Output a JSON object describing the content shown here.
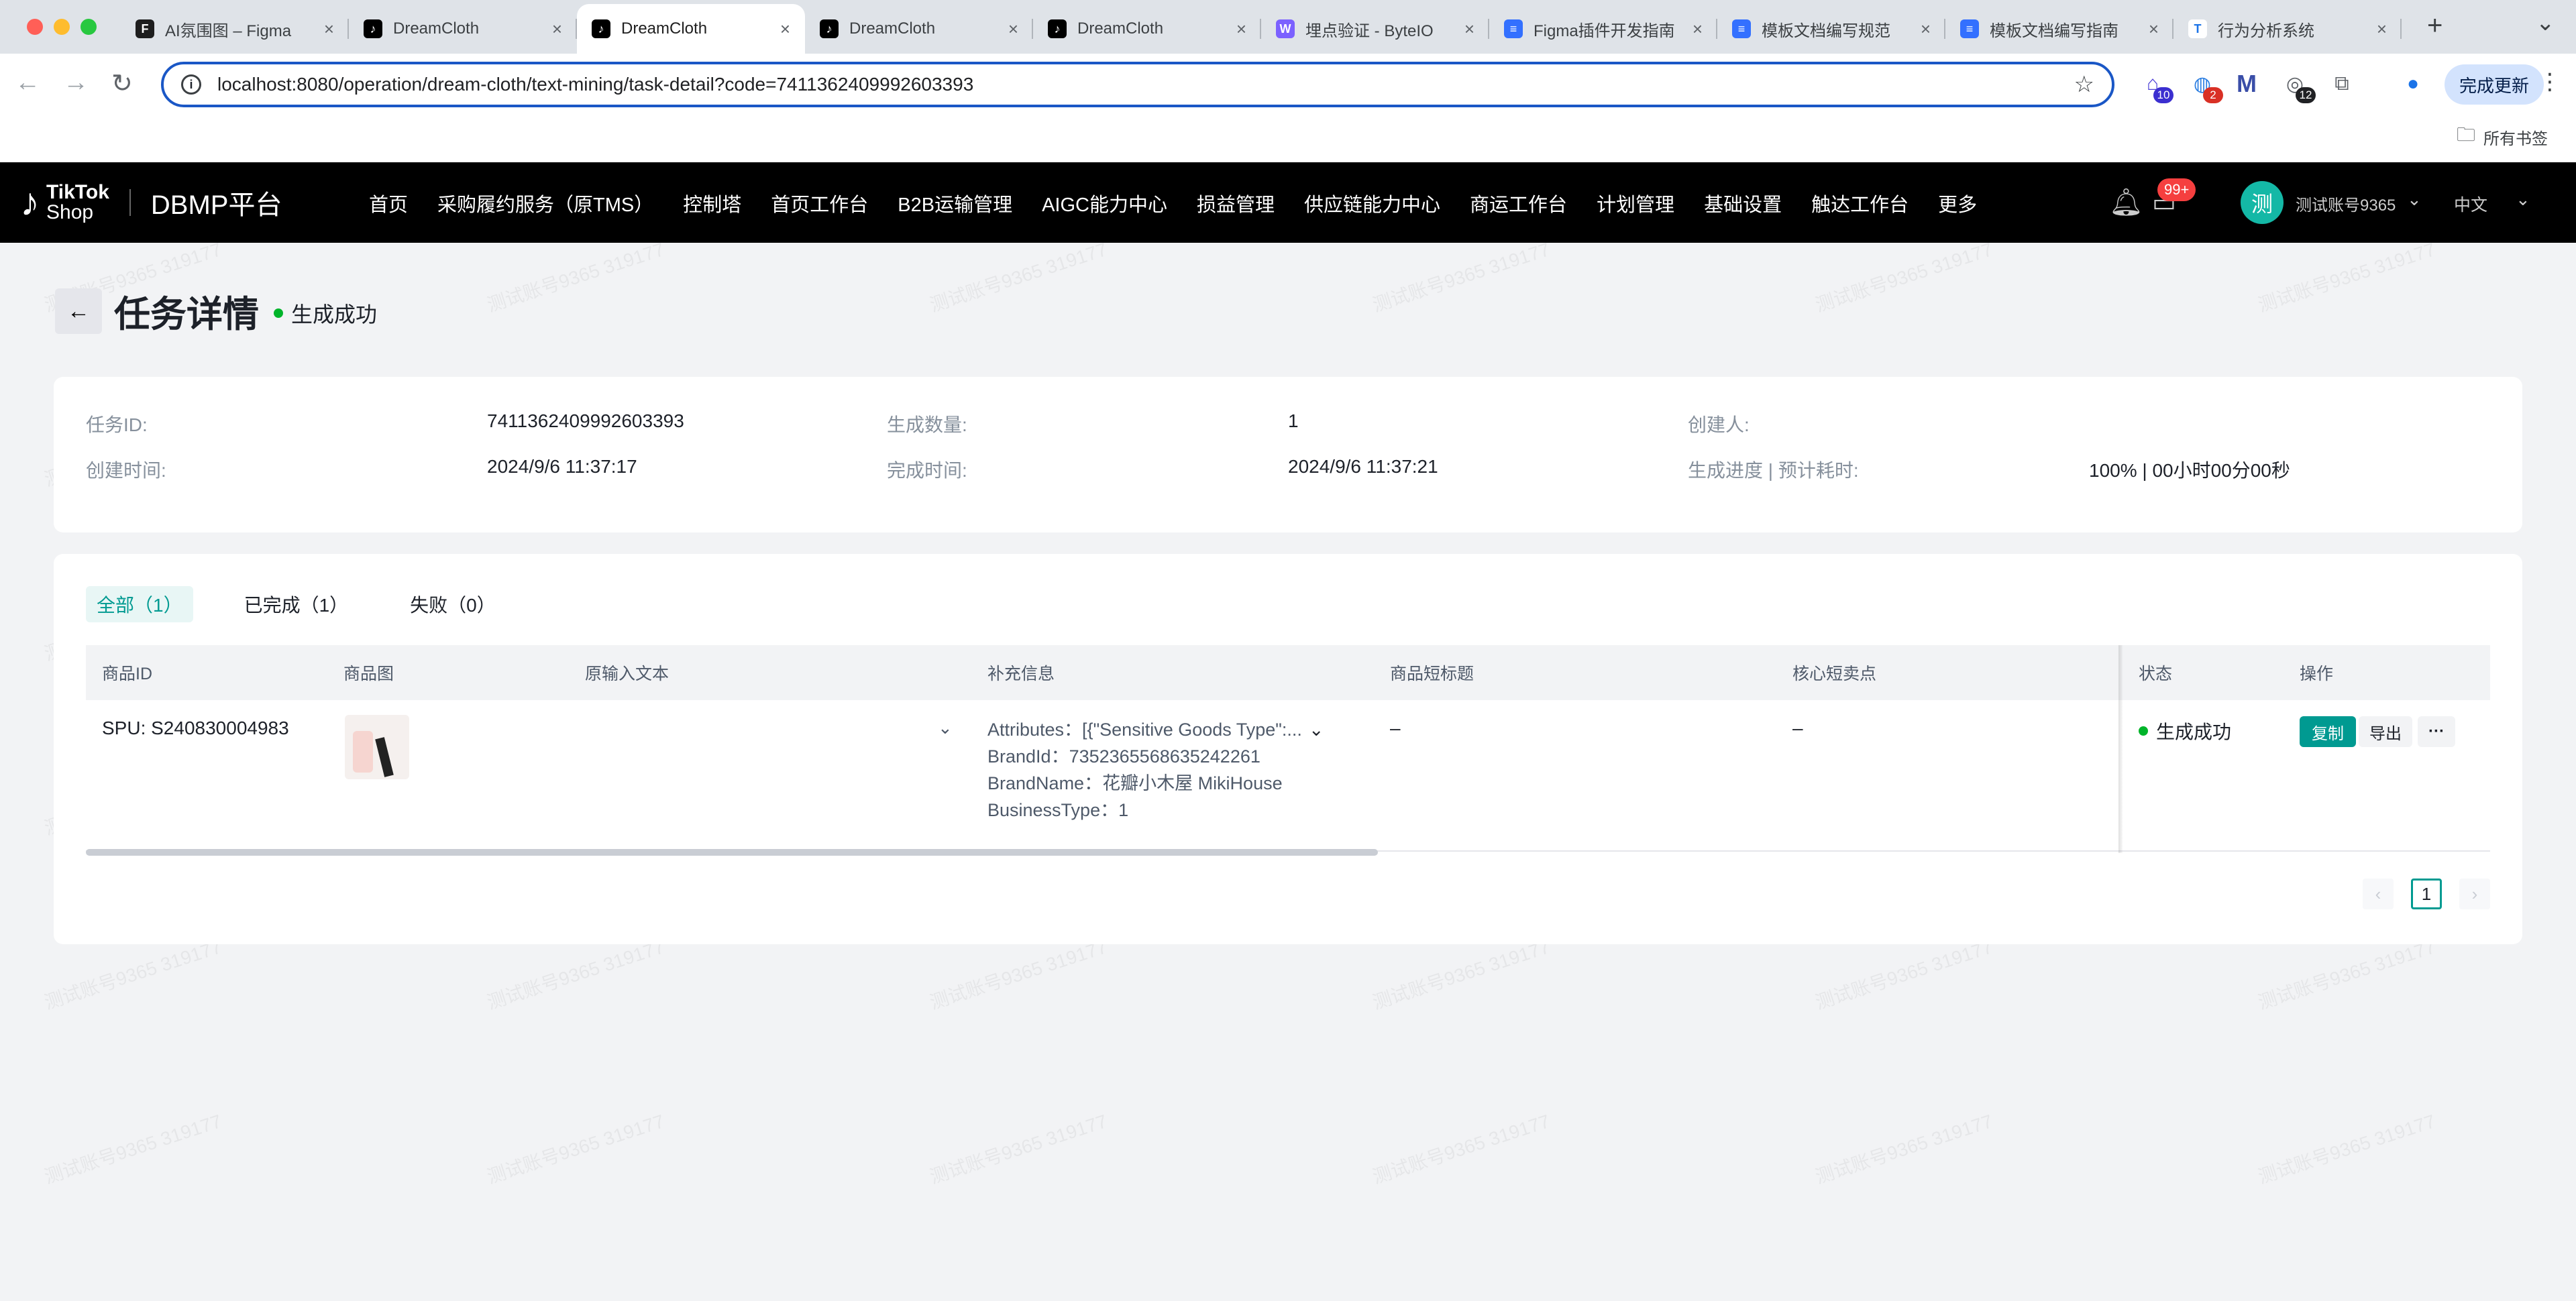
{
  "browser": {
    "tabs": [
      {
        "title": "AI氛围图 – Figma",
        "icon": "figma-icon",
        "active": false
      },
      {
        "title": "DreamCloth",
        "icon": "tiktok-icon",
        "active": false
      },
      {
        "title": "DreamCloth",
        "icon": "tiktok-icon",
        "active": true
      },
      {
        "title": "DreamCloth",
        "icon": "tiktok-icon",
        "active": false
      },
      {
        "title": "DreamCloth",
        "icon": "tiktok-icon",
        "active": false
      },
      {
        "title": "埋点验证 - ByteIO",
        "icon": "byteio-icon",
        "active": false
      },
      {
        "title": "Figma插件开发指南",
        "icon": "doc-icon",
        "active": false
      },
      {
        "title": "模板文档编写规范",
        "icon": "doc-icon",
        "active": false
      },
      {
        "title": "模板文档编写指南",
        "icon": "doc-icon",
        "active": false
      },
      {
        "title": "行为分析系统",
        "icon": "t-icon",
        "active": false
      }
    ],
    "url": "localhost:8080/operation/dream-cloth/text-mining/task-detail?code=7411362409992603393",
    "update_label": "完成更新",
    "bookmarks_label": "所有书签",
    "ext_badges": {
      "first": "10",
      "second": "2",
      "fourth": "12"
    }
  },
  "header": {
    "logo_line1": "TikTok",
    "logo_line2": "Shop",
    "platform": "DBMP平台",
    "nav": [
      "首页",
      "采购履约服务（原TMS）",
      "控制塔",
      "首页工作台",
      "B2B运输管理",
      "AIGC能力中心",
      "损益管理",
      "供应链能力中心",
      "商运工作台",
      "计划管理",
      "基础设置",
      "触达工作台",
      "更多"
    ],
    "notif_badge": "99+",
    "avatar_char": "测",
    "user_name": "测试账号9365",
    "lang": "中文"
  },
  "page": {
    "title": "任务详情",
    "status": "生成成功",
    "info": {
      "task_id_label": "任务ID:",
      "task_id": "7411362409992603393",
      "count_label": "生成数量:",
      "count": "1",
      "creator_label": "创建人:",
      "creator": "",
      "created_label": "创建时间:",
      "created": "2024/9/6 11:37:17",
      "finished_label": "完成时间:",
      "finished": "2024/9/6 11:37:21",
      "progress_label": "生成进度 | 预计耗时:",
      "progress": "100% | 00小时00分00秒"
    },
    "filters": [
      {
        "label": "全部（1）",
        "active": true
      },
      {
        "label": "已完成（1）",
        "active": false
      },
      {
        "label": "失败（0）",
        "active": false
      }
    ],
    "columns": [
      "商品ID",
      "商品图",
      "原输入文本",
      "补充信息",
      "商品短标题",
      "核心短卖点",
      "状态",
      "操作"
    ],
    "row": {
      "id": "SPU: S240830004983",
      "extra": [
        "Attributes：[{\"Sensitive Goods Type\":...",
        "BrandId：7352365568635242261",
        "BrandName：花瓣小木屋 MikiHouse",
        "BusinessType：1"
      ],
      "short_title": "–",
      "selling_point": "–",
      "status": "生成成功",
      "copy": "复制",
      "export": "导出"
    },
    "pager": {
      "current": "1"
    },
    "watermark": "测试账号9365 319177"
  }
}
